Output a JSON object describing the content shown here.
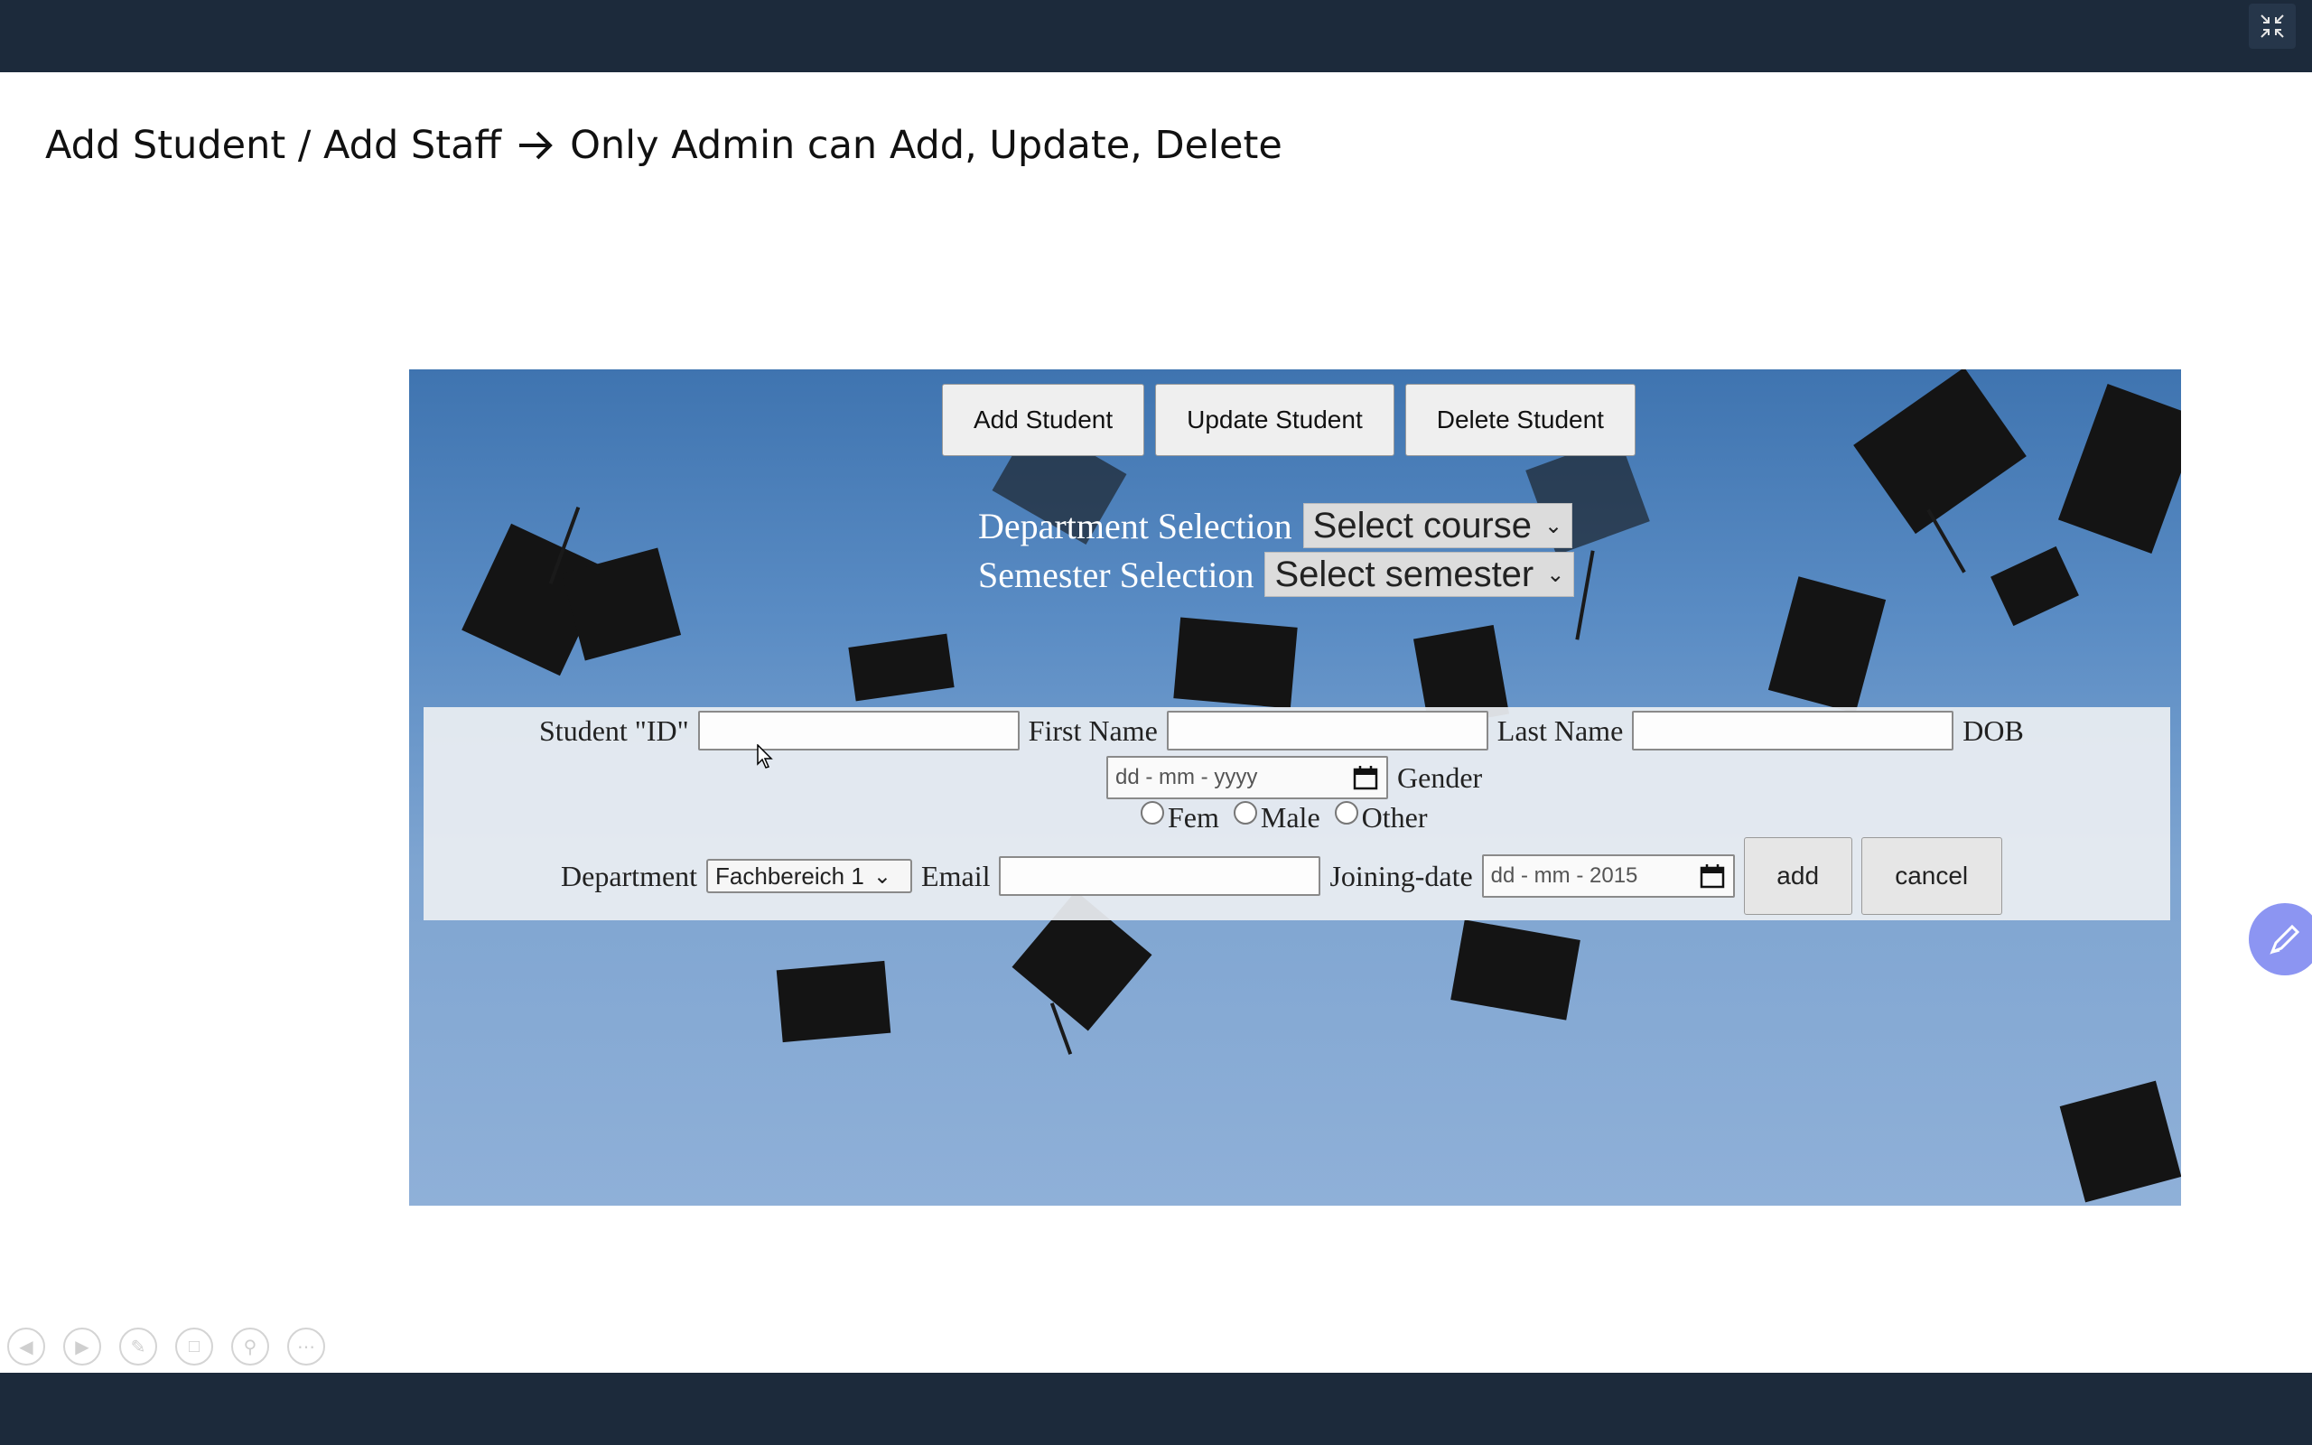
{
  "slide": {
    "title_left": "Add Student / Add Staff",
    "title_right": "Only Admin can Add, Update, Delete"
  },
  "app": {
    "tabs": {
      "add": "Add Student",
      "update": "Update Student",
      "delete": "Delete Student"
    },
    "department_selection": {
      "label": "Department Selection",
      "value": "Select course"
    },
    "semester_selection": {
      "label": "Semester Selection",
      "value": "Select semester"
    },
    "form": {
      "student_id_label": "Student \"ID\"",
      "first_name_label": "First Name",
      "last_name_label": "Last Name",
      "dob_label": "DOB",
      "dob_placeholder": "dd - mm - yyyy",
      "gender_label": "Gender",
      "gender_options": [
        "Fem",
        "Male",
        "Other"
      ],
      "department_label": "Department",
      "department_value": "Fachbereich 1",
      "email_label": "Email",
      "joining_label": "Joining-date",
      "joining_value": "dd - mm - 2015",
      "add_label": "add",
      "cancel_label": "cancel"
    }
  },
  "colors": {
    "bar": "#1c2a3b",
    "sky": "#5a8cc4",
    "pen_button": "#8c95f2"
  },
  "icons": [
    "exit-fullscreen-icon",
    "arrow-right-icon",
    "calendar-icon",
    "chevron-down-icon",
    "pen-icon",
    "prev-slide-icon",
    "next-slide-icon",
    "pen-tool-icon",
    "slides-icon",
    "zoom-icon",
    "more-icon"
  ]
}
